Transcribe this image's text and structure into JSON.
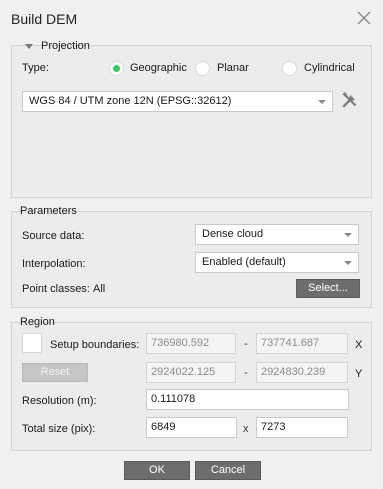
{
  "window": {
    "title": "Build DEM",
    "close_icon": "close-icon"
  },
  "projection": {
    "group_label": "Projection",
    "type_label": "Type:",
    "options": [
      {
        "label": "Geographic",
        "checked": true
      },
      {
        "label": "Planar",
        "checked": false
      },
      {
        "label": "Cylindrical",
        "checked": false
      }
    ],
    "crs_value": "WGS 84 / UTM zone 12N (EPSG::32612)",
    "crs_settings_icon": "tools-icon"
  },
  "parameters": {
    "group_label": "Parameters",
    "source_label": "Source data:",
    "source_value": "Dense cloud",
    "interpolation_label": "Interpolation:",
    "interpolation_value": "Enabled (default)",
    "point_classes_label": "Point classes:",
    "point_classes_value": "All",
    "select_button": "Select..."
  },
  "region": {
    "group_label": "Region",
    "setup_boundaries_label": "Setup boundaries:",
    "setup_boundaries_checked": false,
    "x_min": "736980.592",
    "x_max": "737741.687",
    "x_axis": "X",
    "y_min": "2924022.125",
    "y_max": "2924830.239",
    "y_axis": "Y",
    "range_separator": "-",
    "reset_button": "Reset",
    "resolution_label": "Resolution (m):",
    "resolution_value": "0.111078",
    "total_size_label": "Total size (pix):",
    "size_width": "6849",
    "size_separator": "x",
    "size_height": "7273"
  },
  "footer": {
    "ok_button": "OK",
    "cancel_button": "Cancel"
  },
  "colors": {
    "radio_selected": "#2fce5f",
    "button_bg": "#6d6d6d",
    "dialog_bg": "#f0f0f0"
  }
}
